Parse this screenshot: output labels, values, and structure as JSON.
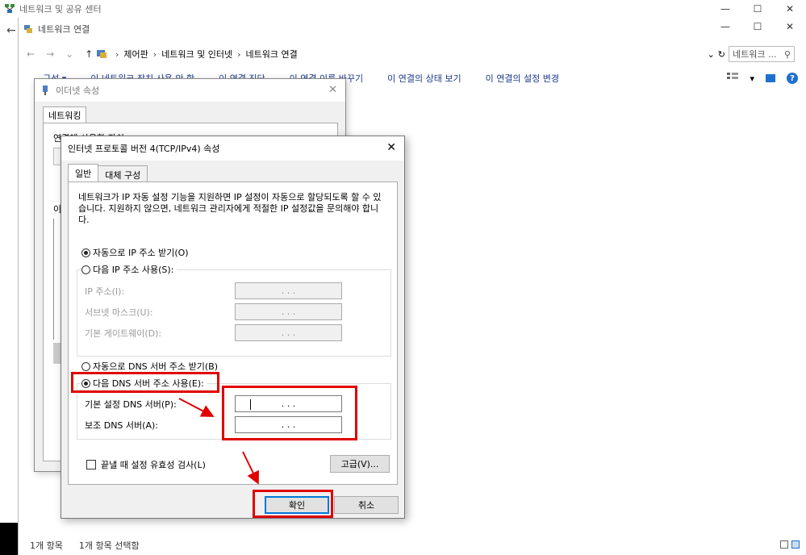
{
  "back_window": {
    "title": "네트워크 및 공유 센터",
    "caption_min": "—",
    "caption_max": "☐",
    "caption_close": "✕",
    "back_arrow": "←"
  },
  "explorer": {
    "title": "네트워크 연결",
    "caption_min": "—",
    "caption_max": "☐",
    "caption_close": "✕",
    "nav": {
      "back": "←",
      "forward": "→",
      "recent": "⌄",
      "up": "↑"
    },
    "breadcrumb": [
      "제어판",
      "네트워크 및 인터넷",
      "네트워크 연결"
    ],
    "breadcrumb_sep": "›",
    "dropdown_glyph": "⌄",
    "refresh_glyph": "↻",
    "search_placeholder": "네트워크 ...",
    "search_glyph": "⚲",
    "commands": [
      "구성 ▾",
      "이 네트워크 장치 사용 안 함",
      "이 연결 진단",
      "이 연결 이름 바꾸기",
      "이 연결의 상태 보기",
      "이 연결의 설정 변경"
    ],
    "view_glyph": "▾",
    "help_glyph": "?",
    "status": {
      "count": "1개 항목",
      "selected": "1개 항목 선택함"
    }
  },
  "ethernet_dialog": {
    "title": "이더넷 속성",
    "tab": "네트워킹",
    "connect_label": "연결에 사용할 장치:",
    "list_label": "이",
    "close": "✕"
  },
  "ipv4_dialog": {
    "title": "인터넷 프로토콜 버전 4(TCP/IPv4) 속성",
    "close": "✕",
    "tabs": [
      "일반",
      "대체 구성"
    ],
    "description": "네트워크가 IP 자동 설정 기능을 지원하면 IP 설정이 자동으로 할당되도록 할 수 있습니다. 지원하지 않으면, 네트워크 관리자에게 적절한 IP 설정값을 문의해야 합니다.",
    "ip_auto": {
      "label": "자동으로 IP 주소 받기(O)",
      "checked": true
    },
    "ip_manual": {
      "label": "다음 IP 주소 사용(S):",
      "checked": false
    },
    "ip_fields": [
      {
        "label": "IP 주소(I):",
        "value": ".   .   ."
      },
      {
        "label": "서브넷 마스크(U):",
        "value": ".   .   ."
      },
      {
        "label": "기본 게이트웨이(D):",
        "value": ".   .   ."
      }
    ],
    "dns_auto": {
      "label": "자동으로 DNS 서버 주소 받기(B)",
      "checked": false
    },
    "dns_manual": {
      "label": "다음 DNS 서버 주소 사용(E):",
      "checked": true
    },
    "dns_fields": [
      {
        "label": "기본 설정 DNS 서버(P):",
        "value": ".   .   ."
      },
      {
        "label": "보조 DNS 서버(A):",
        "value": ".   .   ."
      }
    ],
    "validate": {
      "label": "끝낼 때 설정 유효성 검사(L)",
      "checked": false
    },
    "advanced_button": "고급(V)...",
    "ok_button": "확인",
    "cancel_button": "취소"
  },
  "colors": {
    "annotation": "#e00000",
    "accent": "#0078d7",
    "link": "#1a3a8c"
  }
}
